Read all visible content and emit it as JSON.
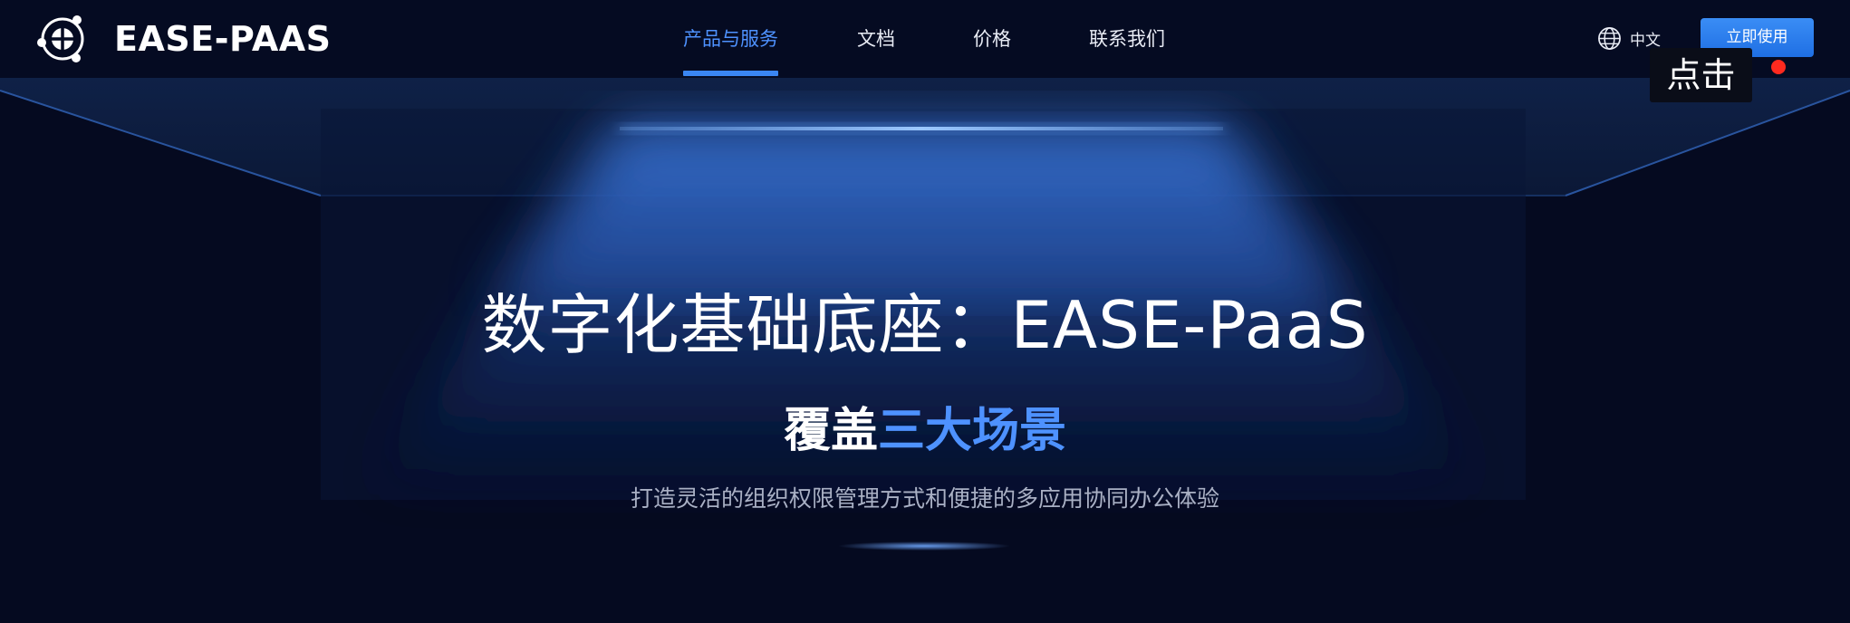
{
  "brand": {
    "name": "EASE-PAAS",
    "logo_icon": "ease-paas-logo-icon"
  },
  "nav": {
    "items": [
      {
        "label": "产品与服务",
        "active": true
      },
      {
        "label": "文档",
        "active": false
      },
      {
        "label": "价格",
        "active": false
      },
      {
        "label": "联系我们",
        "active": false
      }
    ],
    "language": {
      "label": "中文",
      "icon": "globe-icon"
    },
    "cta_label": "立即使用"
  },
  "hero": {
    "title": "数字化基础底座：EASE-PaaS",
    "subtitle_prefix": "覆盖",
    "subtitle_highlight": "三大场景",
    "description": "打造灵活的组织权限管理方式和便捷的多应用协同办公体验"
  },
  "overlay": {
    "tooltip_text": "点击"
  },
  "colors": {
    "accent": "#3a86f2",
    "highlight_text": "#4e92ff",
    "background": "#050a20",
    "click_marker": "#ff2a1f"
  }
}
